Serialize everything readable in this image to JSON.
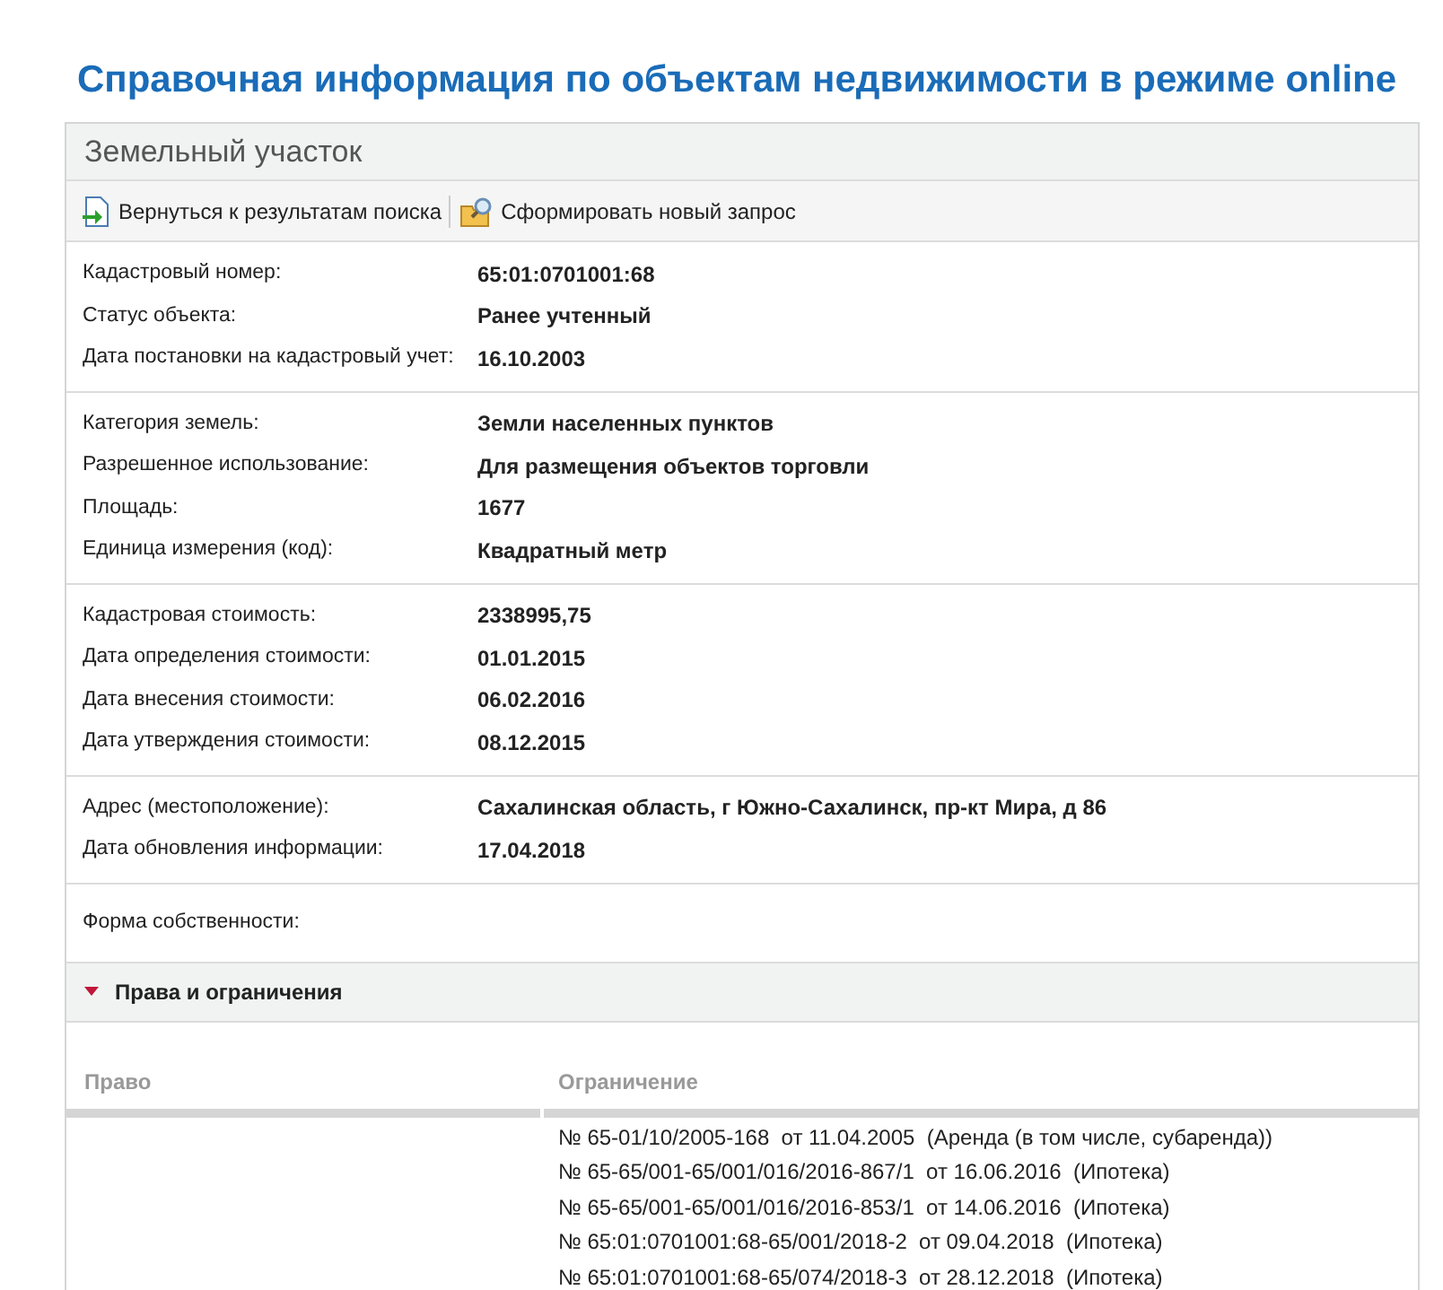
{
  "page_title": "Справочная информация по объектам недвижимости в режиме online",
  "panel": {
    "title": "Земельный участок",
    "toolbar": [
      {
        "label": "Вернуться к результатам поиска",
        "kind": "back"
      },
      {
        "label": "Сформировать новый запрос",
        "kind": "query"
      }
    ],
    "groups": [
      [
        {
          "label": "Кадастровый номер:",
          "value": "65:01:0701001:68"
        },
        {
          "label": "Статус объекта:",
          "value": "Ранее учтенный"
        },
        {
          "label": "Дата постановки на кадастровый учет:",
          "value": "16.10.2003"
        }
      ],
      [
        {
          "label": "Категория земель:",
          "value": "Земли населенных пунктов"
        },
        {
          "label": "Разрешенное использование:",
          "value": "Для размещения объектов торговли"
        },
        {
          "label": "Площадь:",
          "value": "1677"
        },
        {
          "label": "Единица измерения (код):",
          "value": "Квадратный метр"
        }
      ],
      [
        {
          "label": "Кадастровая стоимость:",
          "value": "2338995,75"
        },
        {
          "label": "Дата определения стоимости:",
          "value": "01.01.2015"
        },
        {
          "label": "Дата внесения стоимости:",
          "value": "06.02.2016"
        },
        {
          "label": "Дата утверждения стоимости:",
          "value": "08.12.2015"
        }
      ],
      [
        {
          "label": "Адрес (местоположение):",
          "value": "Сахалинская область, г Южно-Сахалинск, пр-кт Мира, д 86"
        },
        {
          "label": "Дата обновления информации:",
          "value": "17.04.2018"
        }
      ],
      [
        {
          "label": "Форма собственности:"
        }
      ]
    ],
    "rights_section": {
      "title": "Права и ограничения",
      "expanded": true,
      "columns": [
        "Право",
        "Ограничение"
      ],
      "restrictions": [
        "№ 65-01/10/2005-168  от 11.04.2005  (Аренда (в том числе, субаренда))",
        "№ 65-65/001-65/001/016/2016-867/1  от 16.06.2016  (Ипотека)",
        "№ 65-65/001-65/001/016/2016-853/1  от 14.06.2016  (Ипотека)",
        "№ 65:01:0701001:68-65/001/2018-2  от 09.04.2018  (Ипотека)",
        "№ 65:01:0701001:68-65/074/2018-3  от 28.12.2018  (Ипотека)"
      ]
    }
  }
}
